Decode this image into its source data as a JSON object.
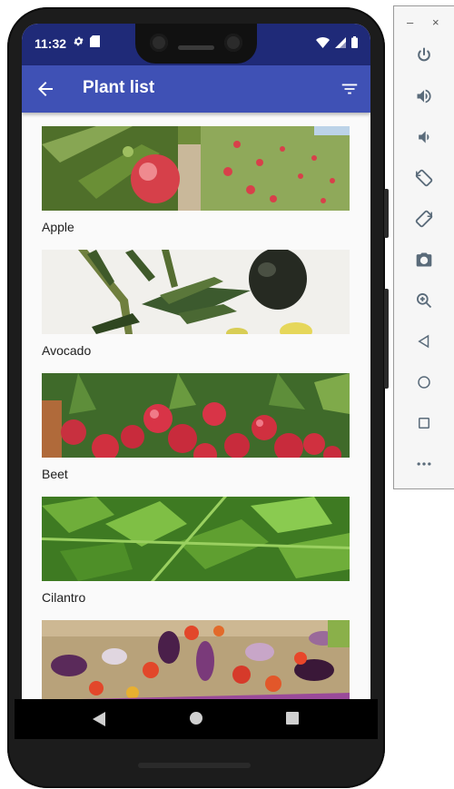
{
  "status_bar": {
    "time": "11:32"
  },
  "app_bar": {
    "title": "Plant list"
  },
  "plants": [
    {
      "name": "Apple"
    },
    {
      "name": "Avocado"
    },
    {
      "name": "Beet"
    },
    {
      "name": "Cilantro"
    },
    {
      "name": ""
    }
  ],
  "emulator_panel": {
    "minimize": "–",
    "close": "×",
    "buttons": [
      "power",
      "volume-up",
      "volume-down",
      "rotate-left",
      "rotate-right",
      "screenshot",
      "zoom",
      "back",
      "home",
      "overview",
      "more"
    ]
  },
  "colors": {
    "app_bar": "#3f51b5",
    "status_bar": "#1f2a78"
  }
}
